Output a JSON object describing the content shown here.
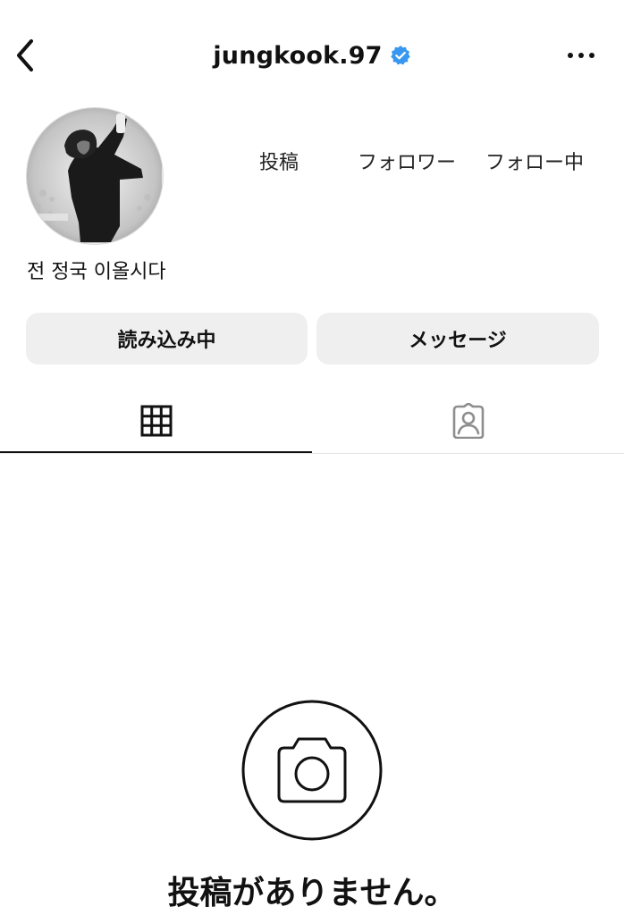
{
  "header": {
    "username": "jungkook.97",
    "back_icon": "chevron-left-icon",
    "verified_icon": "verified-badge-icon",
    "more_icon": "more-horizontal-icon"
  },
  "profile": {
    "avatar_icon": "profile-photo",
    "stats": [
      {
        "label": "投稿",
        "value": ""
      },
      {
        "label": "フォロワー",
        "value": ""
      },
      {
        "label": "フォロー中",
        "value": ""
      }
    ],
    "bio_name": "전 정국 이올시다"
  },
  "actions": {
    "following_label": "読み込み中",
    "message_label": "メッセージ"
  },
  "tabs": [
    {
      "name": "posts",
      "icon": "grid-icon",
      "active": true
    },
    {
      "name": "tagged",
      "icon": "tagged-icon",
      "active": false
    }
  ],
  "empty_state": {
    "icon": "camera-icon",
    "message": "投稿がありません。"
  },
  "colors": {
    "verified_blue": "#3897f0",
    "button_bg": "#efefef",
    "text": "#111111"
  }
}
